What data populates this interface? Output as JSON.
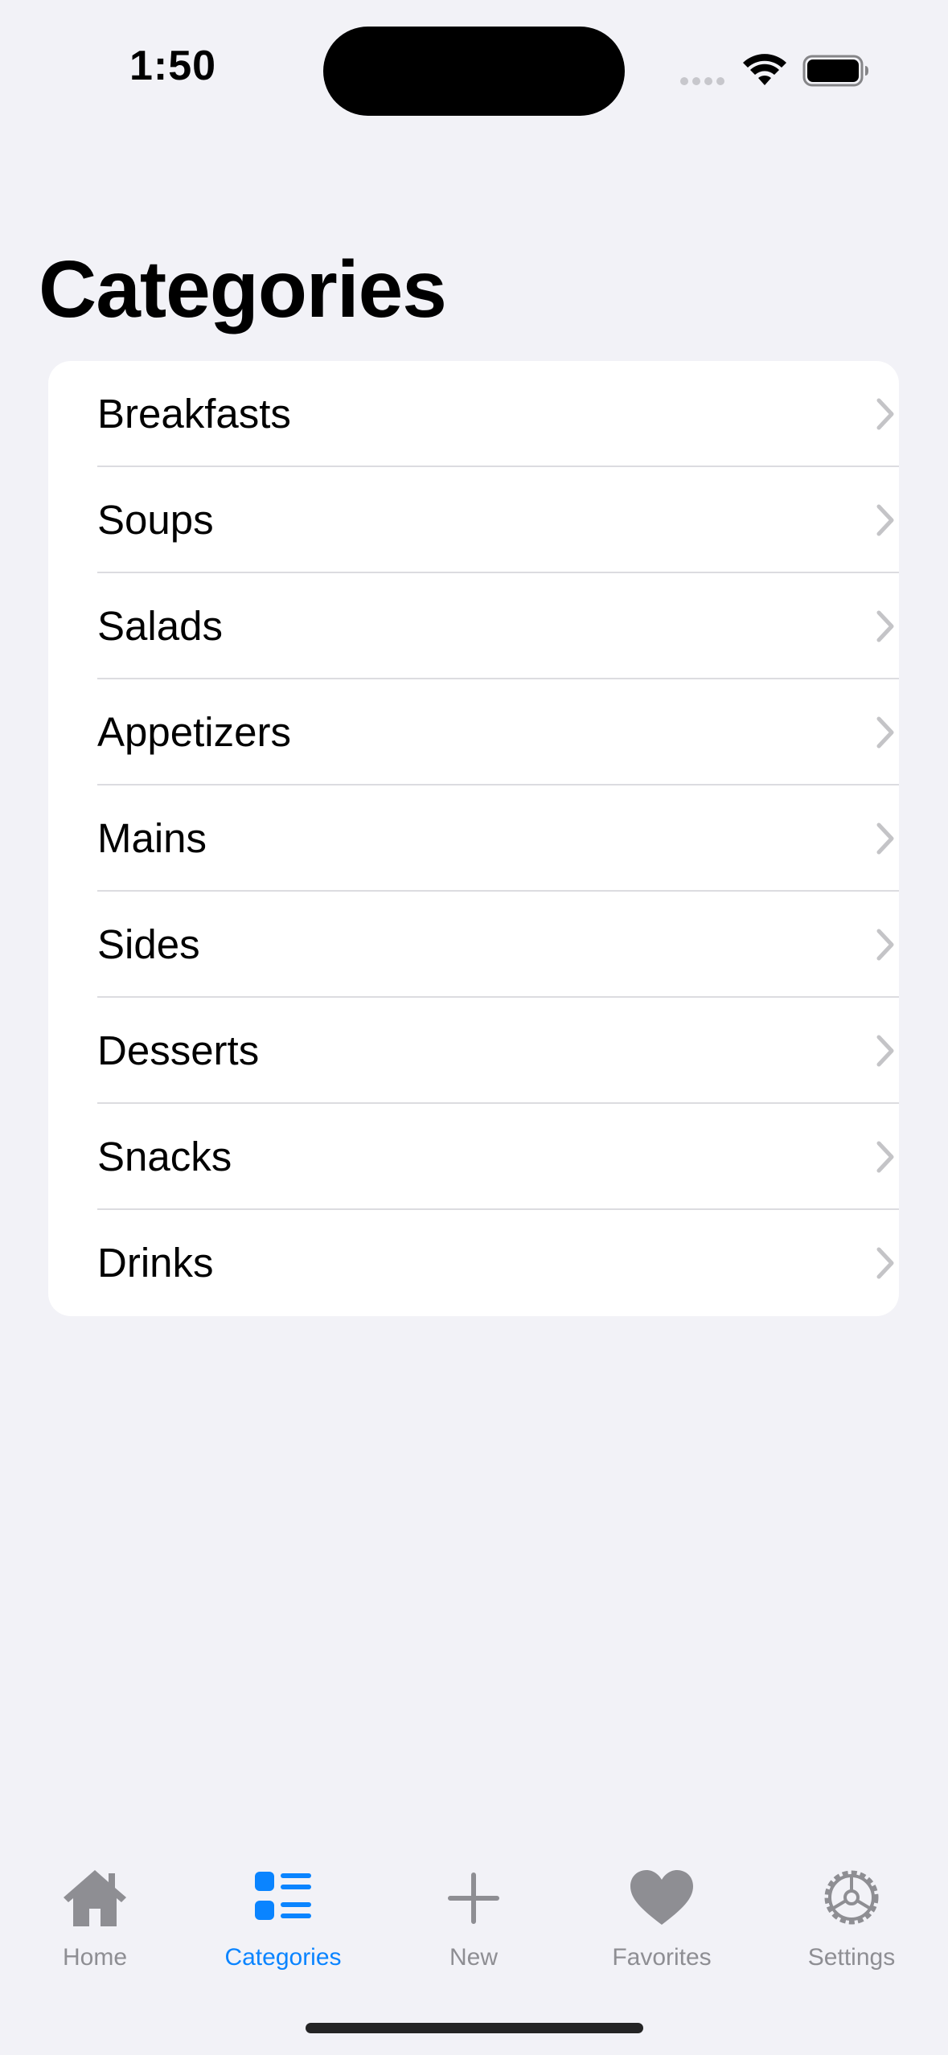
{
  "status_bar": {
    "time": "1:50"
  },
  "page": {
    "title": "Categories"
  },
  "categories": [
    {
      "label": "Breakfasts"
    },
    {
      "label": "Soups"
    },
    {
      "label": "Salads"
    },
    {
      "label": "Appetizers"
    },
    {
      "label": "Mains"
    },
    {
      "label": "Sides"
    },
    {
      "label": "Desserts"
    },
    {
      "label": "Snacks"
    },
    {
      "label": "Drinks"
    }
  ],
  "tab_bar": {
    "tabs": [
      {
        "label": "Home",
        "icon": "house-icon",
        "active": false
      },
      {
        "label": "Categories",
        "icon": "list-bullet-icon",
        "active": true
      },
      {
        "label": "New",
        "icon": "plus-icon",
        "active": false
      },
      {
        "label": "Favorites",
        "icon": "heart-icon",
        "active": false
      },
      {
        "label": "Settings",
        "icon": "gear-icon",
        "active": false
      }
    ]
  },
  "colors": {
    "background": "#F2F2F7",
    "card": "#FFFFFF",
    "accent": "#0A84FF",
    "inactive": "#8E8E93",
    "chevron": "#C4C4C7"
  }
}
